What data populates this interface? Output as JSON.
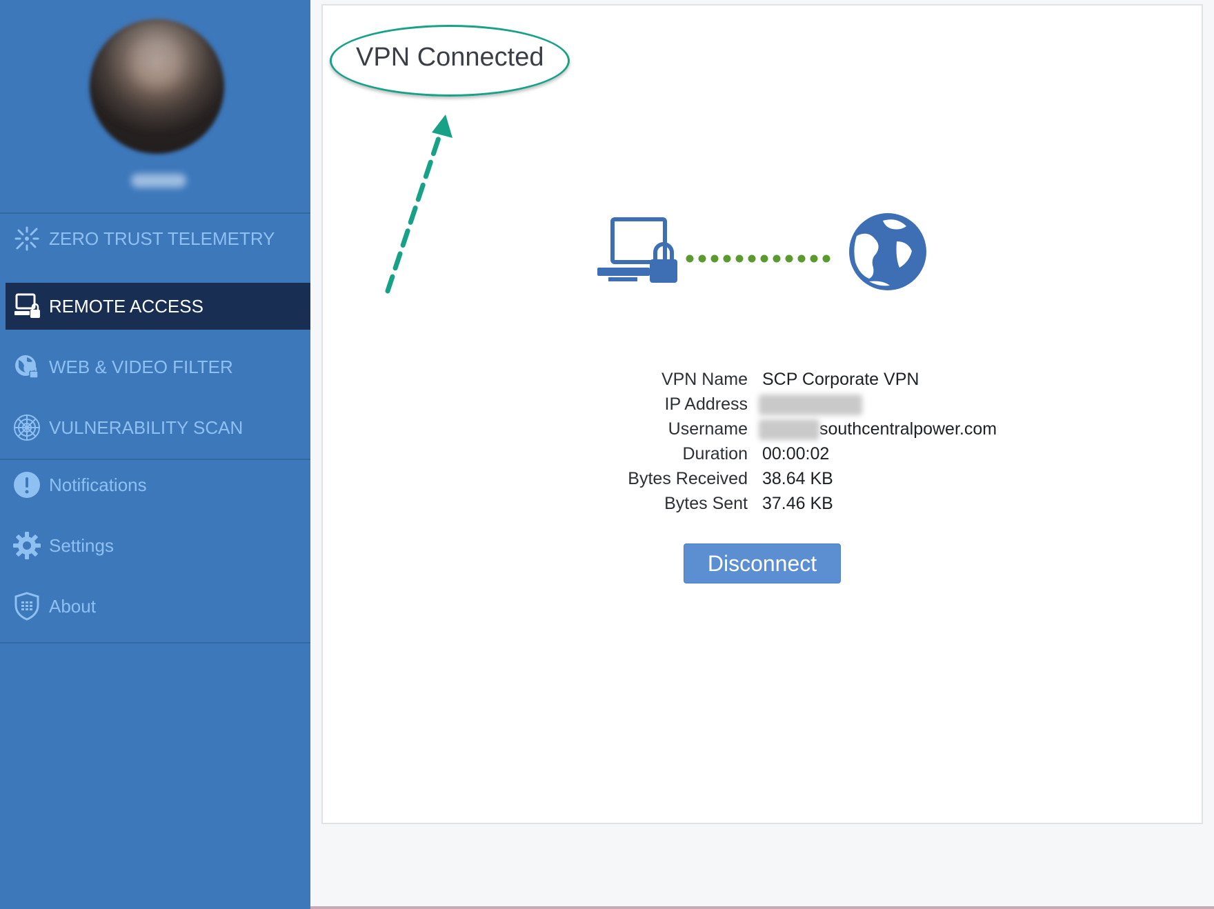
{
  "sidebar": {
    "sections": [
      {
        "items": [
          {
            "label": "ZERO TRUST TELEMETRY",
            "icon": "zero-trust-icon",
            "active": false
          },
          {
            "label": "REMOTE ACCESS",
            "icon": "remote-access-icon",
            "active": true
          },
          {
            "label": "WEB & VIDEO FILTER",
            "icon": "web-filter-globe-icon",
            "active": false
          },
          {
            "label": "VULNERABILITY SCAN",
            "icon": "vulnerability-scan-icon",
            "active": false
          }
        ]
      },
      {
        "items": [
          {
            "label": "Notifications",
            "icon": "exclamation-icon",
            "active": false
          },
          {
            "label": "Settings",
            "icon": "gear-icon",
            "active": false
          },
          {
            "label": "About",
            "icon": "shield-icon",
            "active": false
          }
        ]
      }
    ]
  },
  "main": {
    "status_title": "VPN Connected",
    "details": [
      {
        "key": "VPN Name",
        "value": "SCP Corporate VPN"
      },
      {
        "key": "IP Address",
        "value": ""
      },
      {
        "key": "Username",
        "value": "southcentralpower.com"
      },
      {
        "key": "Duration",
        "value": "00:00:02"
      },
      {
        "key": "Bytes Received",
        "value": "38.64 KB"
      },
      {
        "key": "Bytes Sent",
        "value": "37.46 KB"
      }
    ],
    "disconnect_label": "Disconnect"
  },
  "colors": {
    "sidebar_bg": "#3d78bb",
    "sidebar_active_bg": "#182e52",
    "nav_text": "#8fc0f2",
    "annotation": "#17a287",
    "connection_dots": "#5a9a2f",
    "button": "#5b8fd2"
  }
}
